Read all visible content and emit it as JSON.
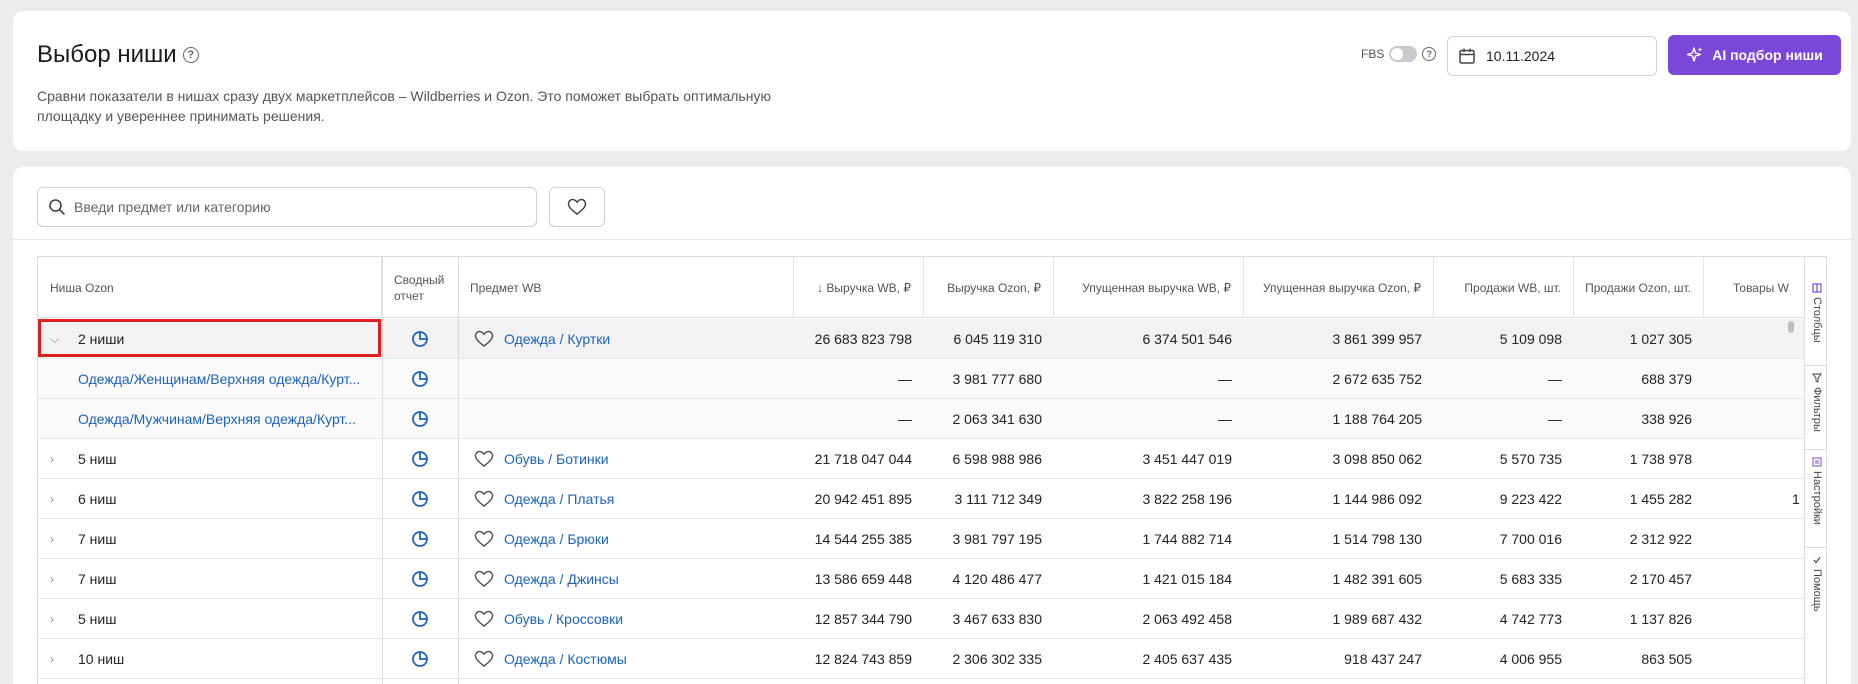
{
  "header": {
    "title": "Выбор ниши",
    "subtitle_line1": "Сравни показатели в нишах сразу двух маркетплейсов – Wildberries и Ozon. Это поможет выбрать оптимальную",
    "subtitle_line2": "площадку и увереннее принимать решения.",
    "fbs_label": "FBS",
    "date_value": "10.11.2024",
    "ai_button": "AI подбор ниши"
  },
  "search": {
    "placeholder": "Введи предмет или категорию"
  },
  "table": {
    "columns": {
      "niche": "Ниша Ozon",
      "report_line1": "Сводный",
      "report_line2": "отчет",
      "subject": "Предмет WB",
      "rev_wb": "↓ Выручка WB, ₽",
      "rev_ozon": "Выручка Ozon, ₽",
      "lost_wb": "Упущенная выручка WB, ₽",
      "lost_ozon": "Упущенная выручка Ozon, ₽",
      "sales_wb": "Продажи WB, шт.",
      "sales_ozon": "Продажи Ozon, шт.",
      "goods": "Товары W"
    },
    "rows": [
      {
        "niche": "2 ниши",
        "subject": "Одежда / Куртки",
        "rev_wb": "26 683 823 798",
        "rev_ozon": "6 045 119 310",
        "lost_wb": "6 374 501 546",
        "lost_ozon": "3 861 399 957",
        "sales_wb": "5 109 098",
        "sales_ozon": "1 027 305",
        "goods": ""
      },
      {
        "niche": "Одежда/Женщинам/Верхняя одежда/Курт...",
        "subject": "",
        "rev_wb": "—",
        "rev_ozon": "3 981 777 680",
        "lost_wb": "—",
        "lost_ozon": "2 672 635 752",
        "sales_wb": "—",
        "sales_ozon": "688 379",
        "goods": ""
      },
      {
        "niche": "Одежда/Мужчинам/Верхняя одежда/Курт...",
        "subject": "",
        "rev_wb": "—",
        "rev_ozon": "2 063 341 630",
        "lost_wb": "—",
        "lost_ozon": "1 188 764 205",
        "sales_wb": "—",
        "sales_ozon": "338 926",
        "goods": ""
      },
      {
        "niche": "5 ниш",
        "subject": "Обувь / Ботинки",
        "rev_wb": "21 718 047 044",
        "rev_ozon": "6 598 988 986",
        "lost_wb": "3 451 447 019",
        "lost_ozon": "3 098 850 062",
        "sales_wb": "5 570 735",
        "sales_ozon": "1 738 978",
        "goods": ""
      },
      {
        "niche": "6 ниш",
        "subject": "Одежда / Платья",
        "rev_wb": "20 942 451 895",
        "rev_ozon": "3 111 712 349",
        "lost_wb": "3 822 258 196",
        "lost_ozon": "1 144 986 092",
        "sales_wb": "9 223 422",
        "sales_ozon": "1 455 282",
        "goods": "1"
      },
      {
        "niche": "7 ниш",
        "subject": "Одежда / Брюки",
        "rev_wb": "14 544 255 385",
        "rev_ozon": "3 981 797 195",
        "lost_wb": "1 744 882 714",
        "lost_ozon": "1 514 798 130",
        "sales_wb": "7 700 016",
        "sales_ozon": "2 312 922",
        "goods": ""
      },
      {
        "niche": "7 ниш",
        "subject": "Одежда / Джинсы",
        "rev_wb": "13 586 659 448",
        "rev_ozon": "4 120 486 477",
        "lost_wb": "1 421 015 184",
        "lost_ozon": "1 482 391 605",
        "sales_wb": "5 683 335",
        "sales_ozon": "2 170 457",
        "goods": ""
      },
      {
        "niche": "5 ниш",
        "subject": "Обувь / Кроссовки",
        "rev_wb": "12 857 344 790",
        "rev_ozon": "3 467 633 830",
        "lost_wb": "2 063 492 458",
        "lost_ozon": "1 989 687 432",
        "sales_wb": "4 742 773",
        "sales_ozon": "1 137 826",
        "goods": ""
      },
      {
        "niche": "10 ниш",
        "subject": "Одежда / Костюмы",
        "rev_wb": "12 824 743 859",
        "rev_ozon": "2 306 302 335",
        "lost_wb": "2 405 637 435",
        "lost_ozon": "918 437 247",
        "sales_wb": "4 006 955",
        "sales_ozon": "863 505",
        "goods": ""
      }
    ]
  },
  "side_panel": {
    "columns": "Столбцы",
    "filters": "Фильтры",
    "settings": "Настройки",
    "help": "Помощь"
  }
}
